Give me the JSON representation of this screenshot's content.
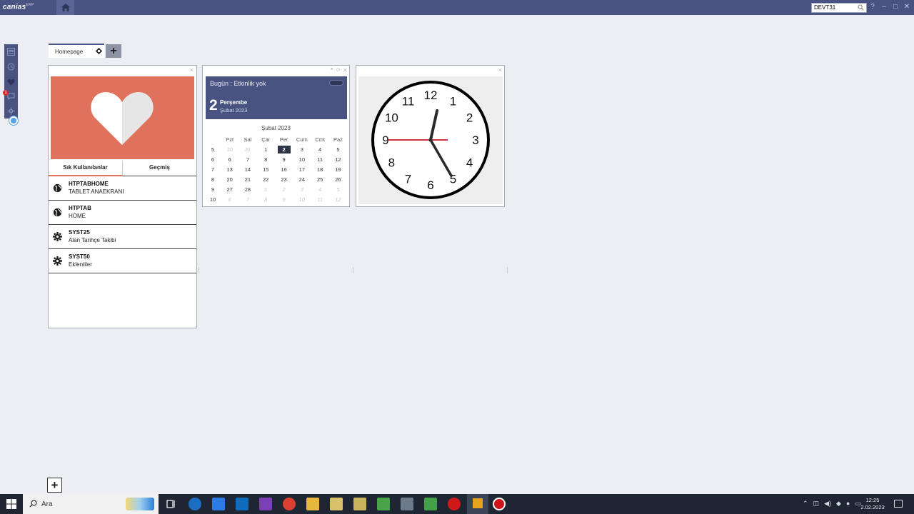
{
  "topbar": {
    "logo": "canias",
    "logo_sup": "ERP",
    "search_value": "DEVT31",
    "colors": {
      "bar": "#485382",
      "accent": "#e0725d"
    }
  },
  "tabs": [
    {
      "label": "Homepage"
    }
  ],
  "favorites_widget": {
    "tabs": [
      "Sık Kullanılanlar",
      "Geçmiş"
    ],
    "active_tab": "Sık Kullanılanlar",
    "items": [
      {
        "code": "HTPTABHOME",
        "desc": "TABLET ANAEKRANI",
        "icon": "globe-icon"
      },
      {
        "code": "HTPTAB",
        "desc": "HOME",
        "icon": "globe-icon"
      },
      {
        "code": "SYST25",
        "desc": "Alan Tarihçe Takibi",
        "icon": "gear-icon"
      },
      {
        "code": "SYST50",
        "desc": "Eklentiler",
        "icon": "gear-icon"
      }
    ]
  },
  "calendar_widget": {
    "today_text": "Bugün : Etkinlik yok",
    "day_number": "2",
    "weekday": "Perşembe",
    "month_year": "Şubat 2023",
    "month_title": "Şubat 2023",
    "headers": [
      "Pzt",
      "Sal",
      "Çar",
      "Per",
      "Cum",
      "Cmt",
      "Paz"
    ],
    "weeks": [
      {
        "wk": "5",
        "days": [
          [
            "30",
            "mute"
          ],
          [
            "31",
            "mute"
          ],
          [
            "1",
            ""
          ],
          [
            "2",
            "sel"
          ],
          [
            "3",
            ""
          ],
          [
            "4",
            ""
          ],
          [
            "5",
            ""
          ]
        ]
      },
      {
        "wk": "6",
        "days": [
          [
            "6",
            ""
          ],
          [
            "7",
            ""
          ],
          [
            "8",
            ""
          ],
          [
            "9",
            ""
          ],
          [
            "10",
            ""
          ],
          [
            "11",
            ""
          ],
          [
            "12",
            ""
          ]
        ]
      },
      {
        "wk": "7",
        "days": [
          [
            "13",
            ""
          ],
          [
            "14",
            ""
          ],
          [
            "15",
            ""
          ],
          [
            "16",
            ""
          ],
          [
            "17",
            ""
          ],
          [
            "18",
            ""
          ],
          [
            "19",
            ""
          ]
        ]
      },
      {
        "wk": "8",
        "days": [
          [
            "20",
            ""
          ],
          [
            "21",
            ""
          ],
          [
            "22",
            ""
          ],
          [
            "23",
            ""
          ],
          [
            "24",
            ""
          ],
          [
            "25",
            ""
          ],
          [
            "26",
            ""
          ]
        ]
      },
      {
        "wk": "9",
        "days": [
          [
            "27",
            ""
          ],
          [
            "28",
            ""
          ],
          [
            "1",
            "mute"
          ],
          [
            "2",
            "mute"
          ],
          [
            "3",
            "mute"
          ],
          [
            "4",
            "mute"
          ],
          [
            "5",
            "mute"
          ]
        ]
      },
      {
        "wk": "10",
        "days": [
          [
            "6",
            "mute"
          ],
          [
            "7",
            "mute"
          ],
          [
            "8",
            "mute"
          ],
          [
            "9",
            "mute"
          ],
          [
            "10",
            "mute"
          ],
          [
            "11",
            "mute"
          ],
          [
            "12",
            "mute"
          ]
        ]
      }
    ]
  },
  "clock_widget": {
    "numbers": [
      "12",
      "1",
      "2",
      "3",
      "4",
      "5",
      "6",
      "7",
      "8",
      "9",
      "10",
      "11"
    ],
    "hour": 12,
    "minute": 25,
    "second": 45
  },
  "taskbar": {
    "search_label": "Ara",
    "time": "12:25",
    "date": "2.02.2023"
  }
}
